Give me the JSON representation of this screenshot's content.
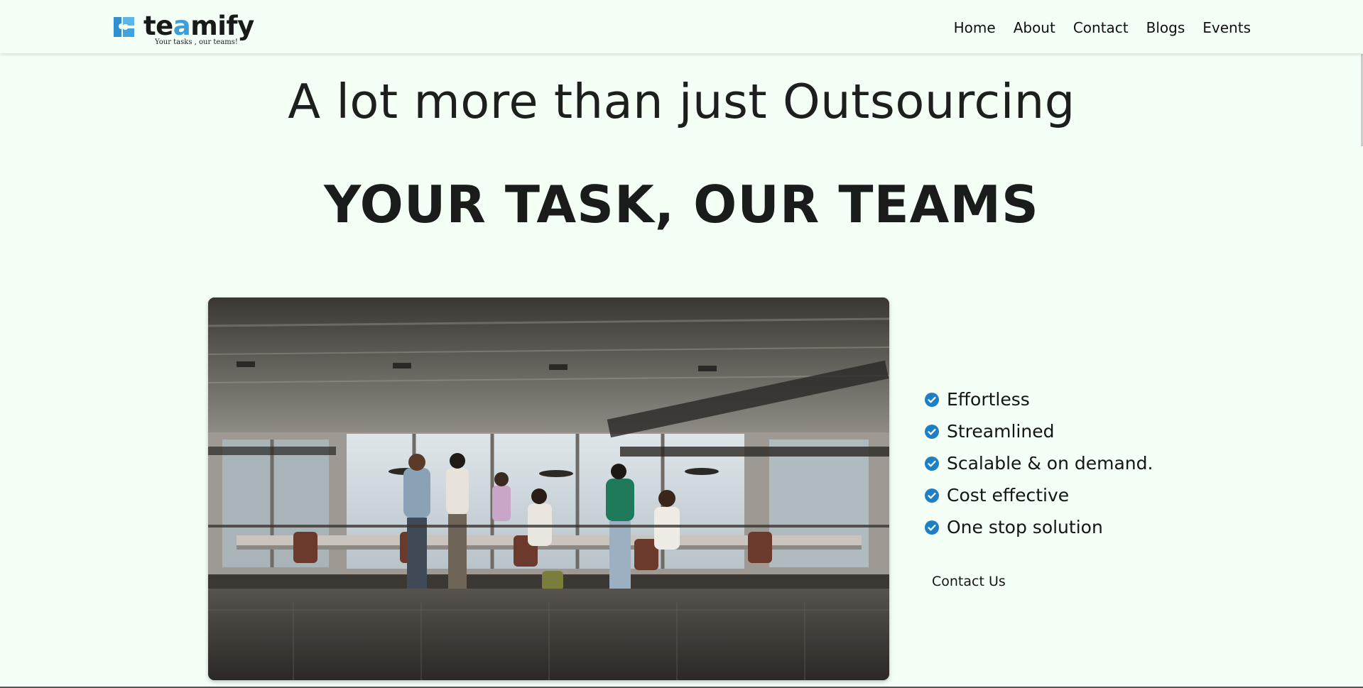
{
  "brand": {
    "name_prefix": "te",
    "name_accent": "a",
    "name_suffix": "mify",
    "tagline": "Your tasks , our teams!",
    "accent_color": "#3e9fd8"
  },
  "nav": {
    "items": [
      {
        "label": "Home"
      },
      {
        "label": "About"
      },
      {
        "label": "Contact"
      },
      {
        "label": "Blogs"
      },
      {
        "label": "Events"
      }
    ]
  },
  "hero": {
    "subtitle": "A lot more than just Outsourcing",
    "headline": "YOUR TASK, OUR TEAMS"
  },
  "features": {
    "icon": "check-circle-icon",
    "icon_color": "#1f7fc4",
    "items": [
      {
        "label": "Effortless"
      },
      {
        "label": "Streamlined"
      },
      {
        "label": "Scalable & on demand."
      },
      {
        "label": "Cost effective"
      },
      {
        "label": "One stop solution"
      }
    ]
  },
  "cta": {
    "contact_label": "Contact Us"
  },
  "colors": {
    "background": "#f4fff6",
    "text": "#1a1d1b"
  }
}
